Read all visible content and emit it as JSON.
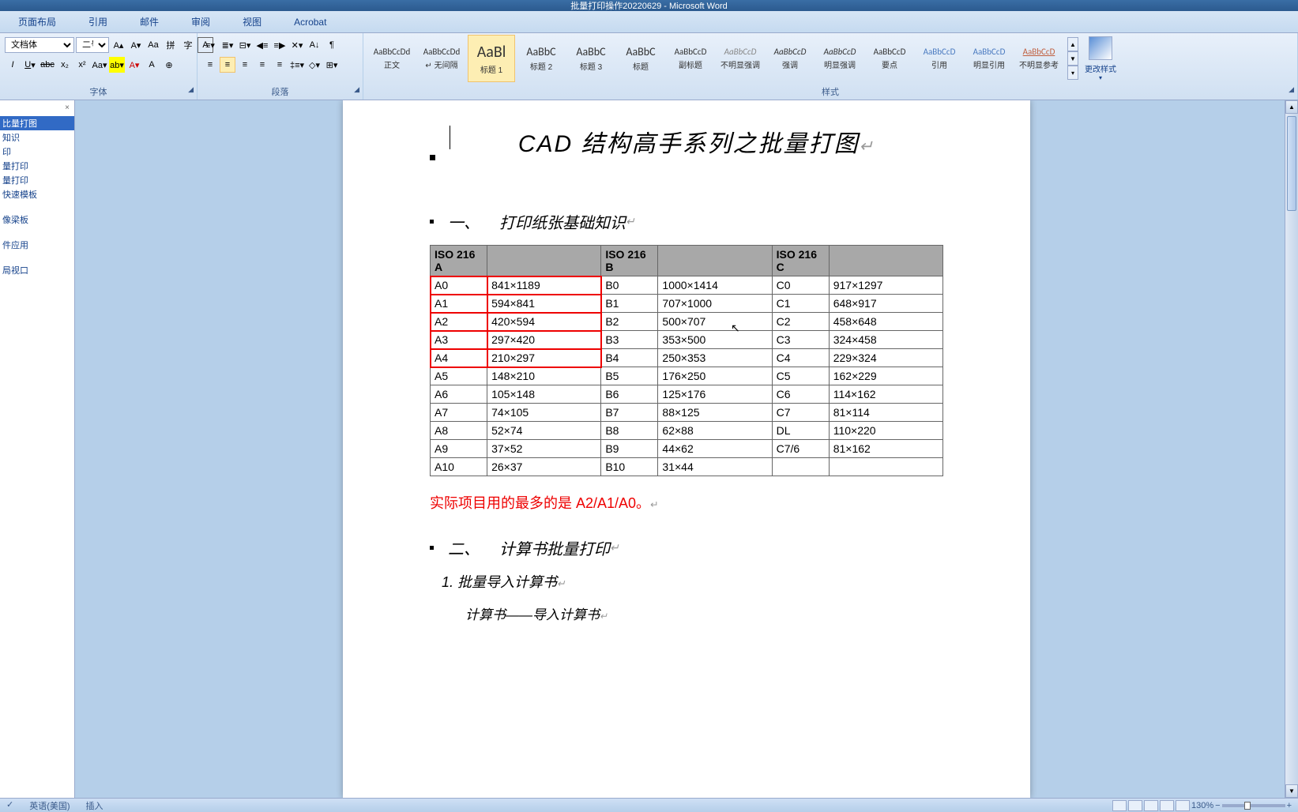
{
  "app": {
    "title": "批量打印操作20220629 - Microsoft Word"
  },
  "tabs": [
    "页面布局",
    "引用",
    "邮件",
    "审阅",
    "视图",
    "Acrobat"
  ],
  "font": {
    "name_value": "文档体",
    "size_value": "二号",
    "group_label": "字体"
  },
  "paragraph": {
    "group_label": "段落"
  },
  "styles": {
    "group_label": "样式",
    "items": [
      {
        "preview": "AaBbCcDd",
        "label": "正文"
      },
      {
        "preview": "AaBbCcDd",
        "label": "无间隔"
      },
      {
        "preview": "AaBl",
        "label": "标题 1"
      },
      {
        "preview": "AaBbC",
        "label": "标题 2"
      },
      {
        "preview": "AaBbC",
        "label": "标题 3"
      },
      {
        "preview": "AaBbC",
        "label": "标题"
      },
      {
        "preview": "AaBbCcD",
        "label": "副标题"
      },
      {
        "preview": "AaBbCcD",
        "label": "不明显强调"
      },
      {
        "preview": "AaBbCcD",
        "label": "强调"
      },
      {
        "preview": "AaBbCcD",
        "label": "明显强调"
      },
      {
        "preview": "AaBbCcD",
        "label": "要点"
      },
      {
        "preview": "AaBbCcD",
        "label": "引用"
      },
      {
        "preview": "AaBbCcD",
        "label": "明显引用"
      },
      {
        "preview": "AaBbCcD",
        "label": "不明显参考"
      }
    ],
    "change_label": "更改样式"
  },
  "nav": {
    "items": [
      "比量打图",
      "知识",
      "印",
      "量打印",
      "量打印",
      "快速模板",
      "像梁板",
      "件应用",
      "局视口"
    ]
  },
  "doc": {
    "title": "CAD 结构高手系列之批量打图",
    "h1_num": "一、",
    "h1_text": "打印纸张基础知识",
    "table": {
      "headers": [
        "ISO 216 A",
        "",
        "ISO 216 B",
        "",
        "ISO 216 C",
        ""
      ],
      "rows": [
        [
          "A0",
          "841×1189",
          "B0",
          "1000×1414",
          "C0",
          "917×1297"
        ],
        [
          "A1",
          "594×841",
          "B1",
          "707×1000",
          "C1",
          "648×917"
        ],
        [
          "A2",
          "420×594",
          "B2",
          "500×707",
          "C2",
          "458×648"
        ],
        [
          "A3",
          "297×420",
          "B3",
          "353×500",
          "C3",
          "324×458"
        ],
        [
          "A4",
          "210×297",
          "B4",
          "250×353",
          "C4",
          "229×324"
        ],
        [
          "A5",
          "148×210",
          "B5",
          "176×250",
          "C5",
          "162×229"
        ],
        [
          "A6",
          "105×148",
          "B6",
          "125×176",
          "C6",
          "114×162"
        ],
        [
          "A7",
          "74×105",
          "B7",
          "88×125",
          "C7",
          "81×114"
        ],
        [
          "A8",
          "52×74",
          "B8",
          "62×88",
          "DL",
          "110×220"
        ],
        [
          "A9",
          "37×52",
          "B9",
          "44×62",
          "C7/6",
          "81×162"
        ],
        [
          "A10",
          "26×37",
          "B10",
          "31×44",
          "",
          ""
        ]
      ]
    },
    "note": "实际项目用的最多的是 A2/A1/A0。",
    "h2_num": "二、",
    "h2_text": "计算书批量打印",
    "li1": "1.  批量导入计算书",
    "sub1": "计算书——导入计算书"
  },
  "status": {
    "left1": "英语(美国)",
    "left2": "插入",
    "zoom": "130%"
  }
}
